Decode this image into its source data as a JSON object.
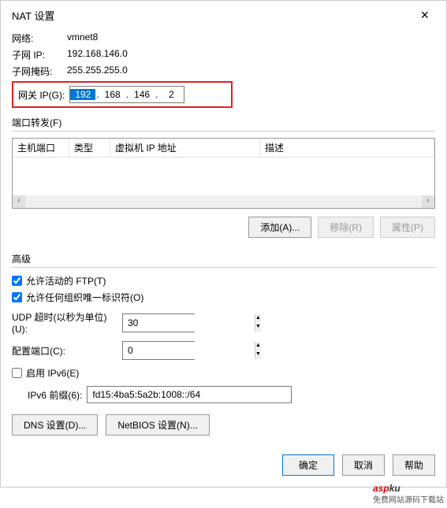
{
  "title": "NAT 设置",
  "info": {
    "network_label": "网络:",
    "network_value": "vmnet8",
    "subnet_ip_label": "子网 IP:",
    "subnet_ip_value": "192.168.146.0",
    "subnet_mask_label": "子网掩码:",
    "subnet_mask_value": "255.255.255.0"
  },
  "gateway": {
    "label": "网关 IP(G):",
    "oct1": "192",
    "oct2": "168",
    "oct3": "146",
    "oct4": "2"
  },
  "port_forward": {
    "title": "端口转发(F)",
    "col_hostport": "主机端口",
    "col_type": "类型",
    "col_vmip": "虚拟机 IP 地址",
    "col_desc": "描述",
    "add": "添加(A)...",
    "remove": "移除(R)",
    "props": "属性(P)"
  },
  "advanced": {
    "title": "高级",
    "allow_ftp": "允许活动的 FTP(T)",
    "allow_oui": "允许任何组织唯一标识符(O)",
    "udp_timeout_label": "UDP 超时(以秒为单位)(U):",
    "udp_timeout_value": "30",
    "config_port_label": "配置端口(C):",
    "config_port_value": "0",
    "enable_ipv6": "启用 IPv6(E)",
    "ipv6_prefix_label": "IPv6 前缀(6):",
    "ipv6_prefix_value": "fd15:4ba5:5a2b:1008::/64",
    "dns_btn": "DNS 设置(D)...",
    "netbios_btn": "NetBIOS 设置(N)..."
  },
  "footer": {
    "ok": "确定",
    "cancel": "取消",
    "help": "帮助"
  },
  "watermark": {
    "a": "asp",
    "b": "ku",
    "sub": "免费网站源码下载站"
  }
}
